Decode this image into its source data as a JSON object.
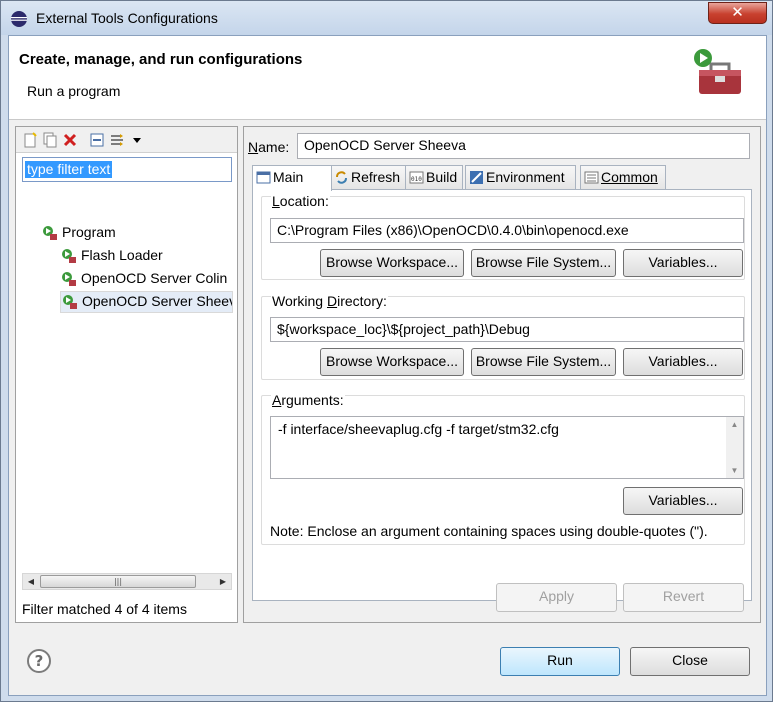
{
  "window": {
    "title": "External Tools Configurations",
    "close_label": "✕"
  },
  "banner": {
    "heading": "Create, manage, and run configurations",
    "subheading": "Run a program"
  },
  "left": {
    "filter_text": "type filter text",
    "tree": [
      {
        "label": "Program"
      },
      {
        "label": "Flash Loader"
      },
      {
        "label": "OpenOCD Server Colin"
      },
      {
        "label": "OpenOCD Server Sheeva"
      }
    ],
    "status": "Filter matched 4 of 4 items"
  },
  "right": {
    "name_label_n": "N",
    "name_label_rest": "ame:",
    "name_value": "OpenOCD Server Sheeva",
    "tabs": [
      "Main",
      "Refresh",
      "Build",
      "Environment",
      "Common"
    ],
    "location": {
      "label_L": "L",
      "label_rest": "ocation:",
      "value": "C:\\Program Files (x86)\\OpenOCD\\0.4.0\\bin\\openocd.exe"
    },
    "working_dir": {
      "label_pre": "Working ",
      "label_u": "D",
      "label_post": "irectory:",
      "value": "${workspace_loc}\\${project_path}\\Debug"
    },
    "arguments": {
      "label_A": "A",
      "label_rest": "rguments:",
      "value": "-f interface/sheevaplug.cfg -f target/stm32.cfg",
      "note": "Note: Enclose an argument containing spaces using double-quotes (\")."
    },
    "buttons": {
      "browse_workspace": "Browse Workspace...",
      "browse_fs": "Browse File System...",
      "variables": "Variables..."
    },
    "apply": "Apply",
    "revert": "Revert"
  },
  "footer": {
    "help": "?",
    "run": "Run",
    "close": "Close"
  }
}
